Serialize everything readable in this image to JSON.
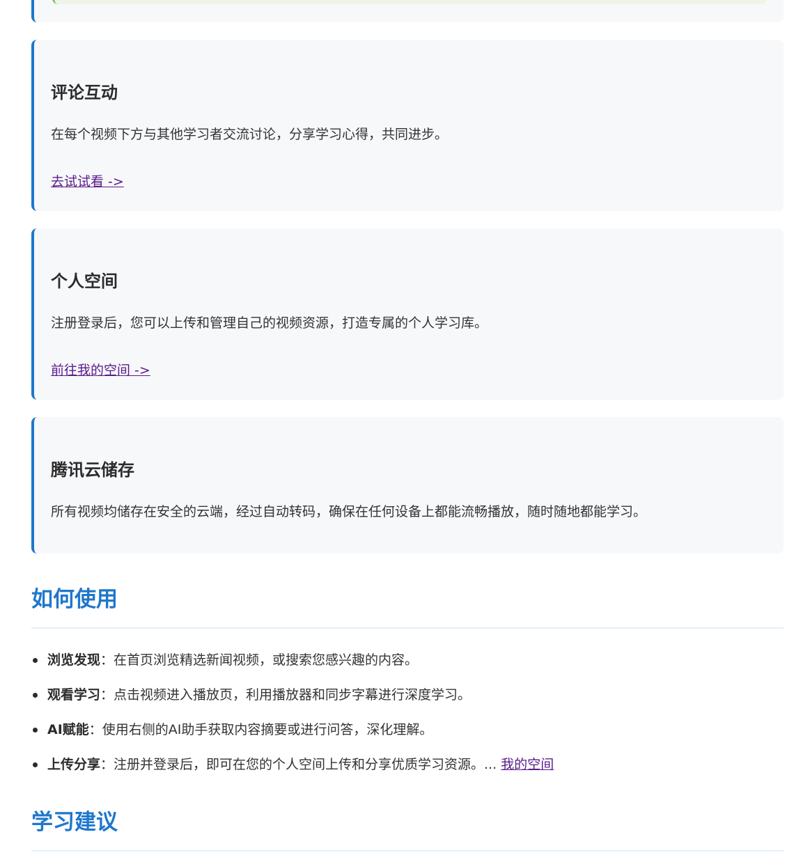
{
  "features": [
    {
      "title": "评论互动",
      "description": "在每个视频下方与其他学习者交流讨论，分享学习心得，共同进步。",
      "link": "去试试看 ->"
    },
    {
      "title": "个人空间",
      "description": "注册登录后，您可以上传和管理自己的视频资源，打造专属的个人学习库。",
      "link": "前往我的空间 ->"
    },
    {
      "title": "腾讯云储存",
      "description": "所有视频均储存在安全的云端，经过自动转码，确保在任何设备上都能流畅播放，随时随地都能学习。"
    }
  ],
  "how_to_use": {
    "title": "如何使用",
    "items": [
      {
        "label": "浏览发现",
        "text": "：在首页浏览精选新闻视频，或搜索您感兴趣的内容。"
      },
      {
        "label": "观看学习",
        "text": "：点击视频进入播放页，利用播放器和同步字幕进行深度学习。"
      },
      {
        "label": "AI赋能",
        "text": "：使用右侧的AI助手获取内容摘要或进行问答，深化理解。"
      },
      {
        "label": "上传分享",
        "text": "：注册并登录后，即可在您的个人空间上传和分享优质学习资源。... ",
        "link": "我的空间"
      }
    ]
  },
  "learning_tips": {
    "title": "学习建议"
  }
}
